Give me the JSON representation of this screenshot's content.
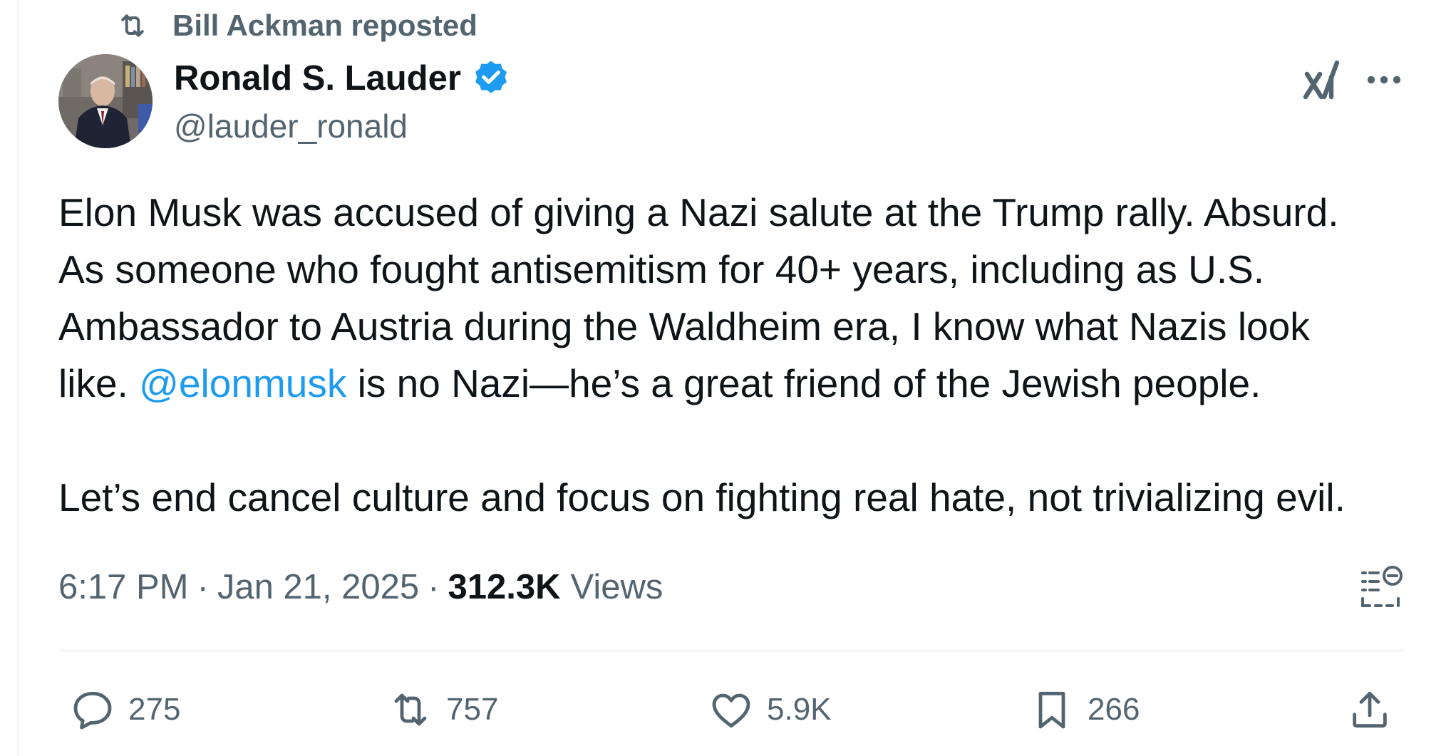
{
  "repost": {
    "label": "Bill Ackman reposted",
    "icon": "repost-icon"
  },
  "author": {
    "display_name": "Ronald S. Lauder",
    "handle": "@lauder_ronald",
    "verified": true,
    "verified_color": "#1d9bf0"
  },
  "header_icons": {
    "grok": "grok-icon",
    "more": "more-icon"
  },
  "tweet": {
    "lines": [
      "Elon Musk was accused of giving a Nazi salute at the Trump rally. Absurd.",
      "As someone who fought antisemitism for 40+ years, including as U.S.",
      "Ambassador to Austria during the Waldheim era, I know what Nazis look"
    ],
    "line4_before": "like. ",
    "mention": "@elonmusk",
    "line4_after": " is no Nazi—he’s a great friend of the Jewish people.",
    "line5": "Let’s end cancel culture and focus on fighting real hate, not trivializing evil."
  },
  "meta": {
    "time": "6:17 PM",
    "separator": "·",
    "date": "Jan 21, 2025",
    "views_count": "312.3K",
    "views_label": "Views"
  },
  "actions": {
    "replies": "275",
    "reposts": "757",
    "likes": "5.9K",
    "bookmarks": "266"
  },
  "colors": {
    "text_primary": "#0f1419",
    "text_secondary": "#536471",
    "link": "#1d9bf0",
    "divider": "#eff3f4"
  }
}
